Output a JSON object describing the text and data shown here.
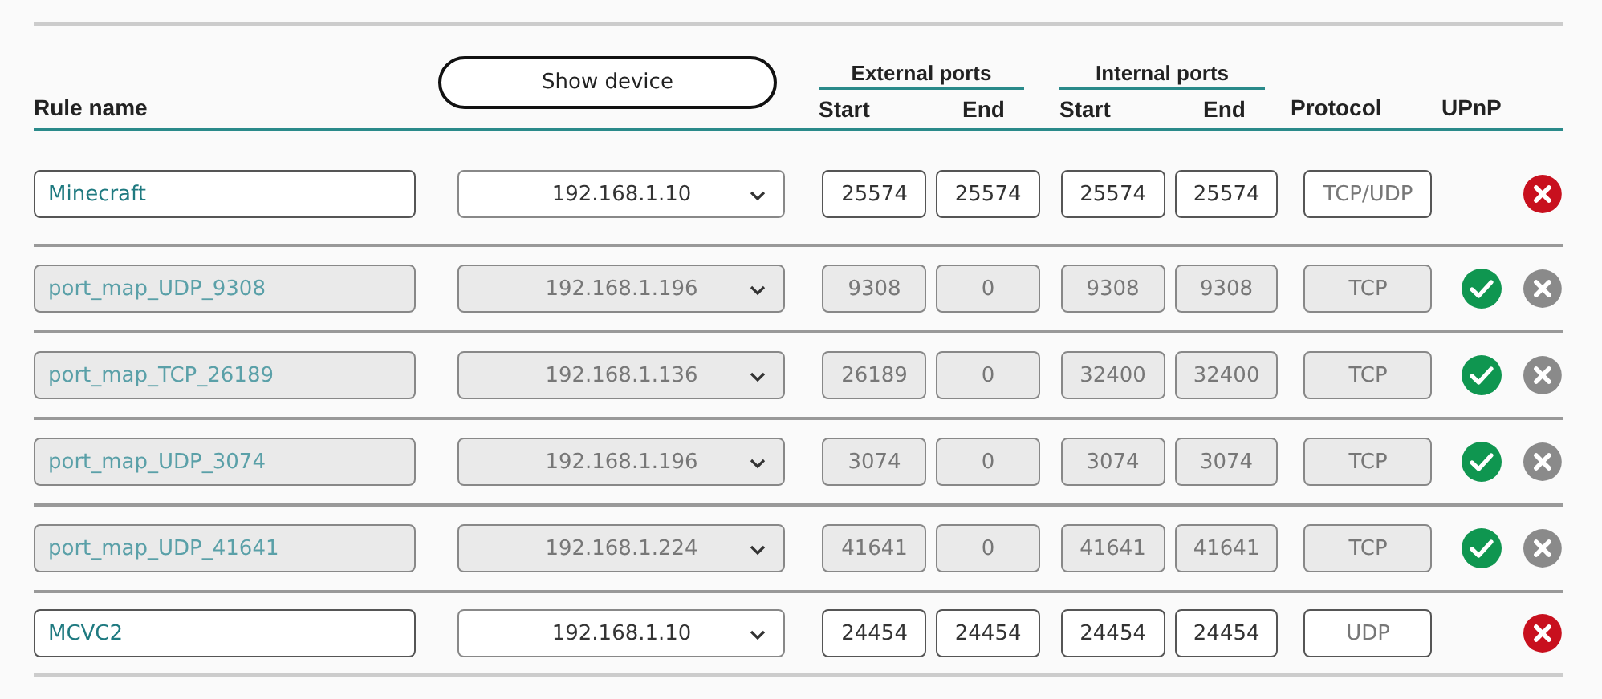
{
  "header": {
    "rule_name": "Rule name",
    "show_device_button": "Show device",
    "external_ports": "External ports",
    "internal_ports": "Internal ports",
    "ext_start": "Start",
    "ext_end": "End",
    "int_start": "Start",
    "int_end": "End",
    "protocol": "Protocol",
    "upnp": "UPnP"
  },
  "rules": [
    {
      "name": "Minecraft",
      "device": "192.168.1.10",
      "ext_start": "25574",
      "ext_end": "25574",
      "int_start": "25574",
      "int_end": "25574",
      "protocol": "TCP/UDP",
      "disabled": false,
      "upnp": false
    },
    {
      "name": "port_map_UDP_9308",
      "device": "192.168.1.196",
      "ext_start": "9308",
      "ext_end": "0",
      "int_start": "9308",
      "int_end": "9308",
      "protocol": "TCP",
      "disabled": true,
      "upnp": true
    },
    {
      "name": "port_map_TCP_26189",
      "device": "192.168.1.136",
      "ext_start": "26189",
      "ext_end": "0",
      "int_start": "32400",
      "int_end": "32400",
      "protocol": "TCP",
      "disabled": true,
      "upnp": true
    },
    {
      "name": "port_map_UDP_3074",
      "device": "192.168.1.196",
      "ext_start": "3074",
      "ext_end": "0",
      "int_start": "3074",
      "int_end": "3074",
      "protocol": "TCP",
      "disabled": true,
      "upnp": true
    },
    {
      "name": "port_map_UDP_41641",
      "device": "192.168.1.224",
      "ext_start": "41641",
      "ext_end": "0",
      "int_start": "41641",
      "int_end": "41641",
      "protocol": "TCP",
      "disabled": true,
      "upnp": true
    },
    {
      "name": "MCVC2",
      "device": "192.168.1.10",
      "ext_start": "24454",
      "ext_end": "24454",
      "int_start": "24454",
      "int_end": "24454",
      "protocol": "UDP",
      "disabled": false,
      "upnp": false
    }
  ]
}
